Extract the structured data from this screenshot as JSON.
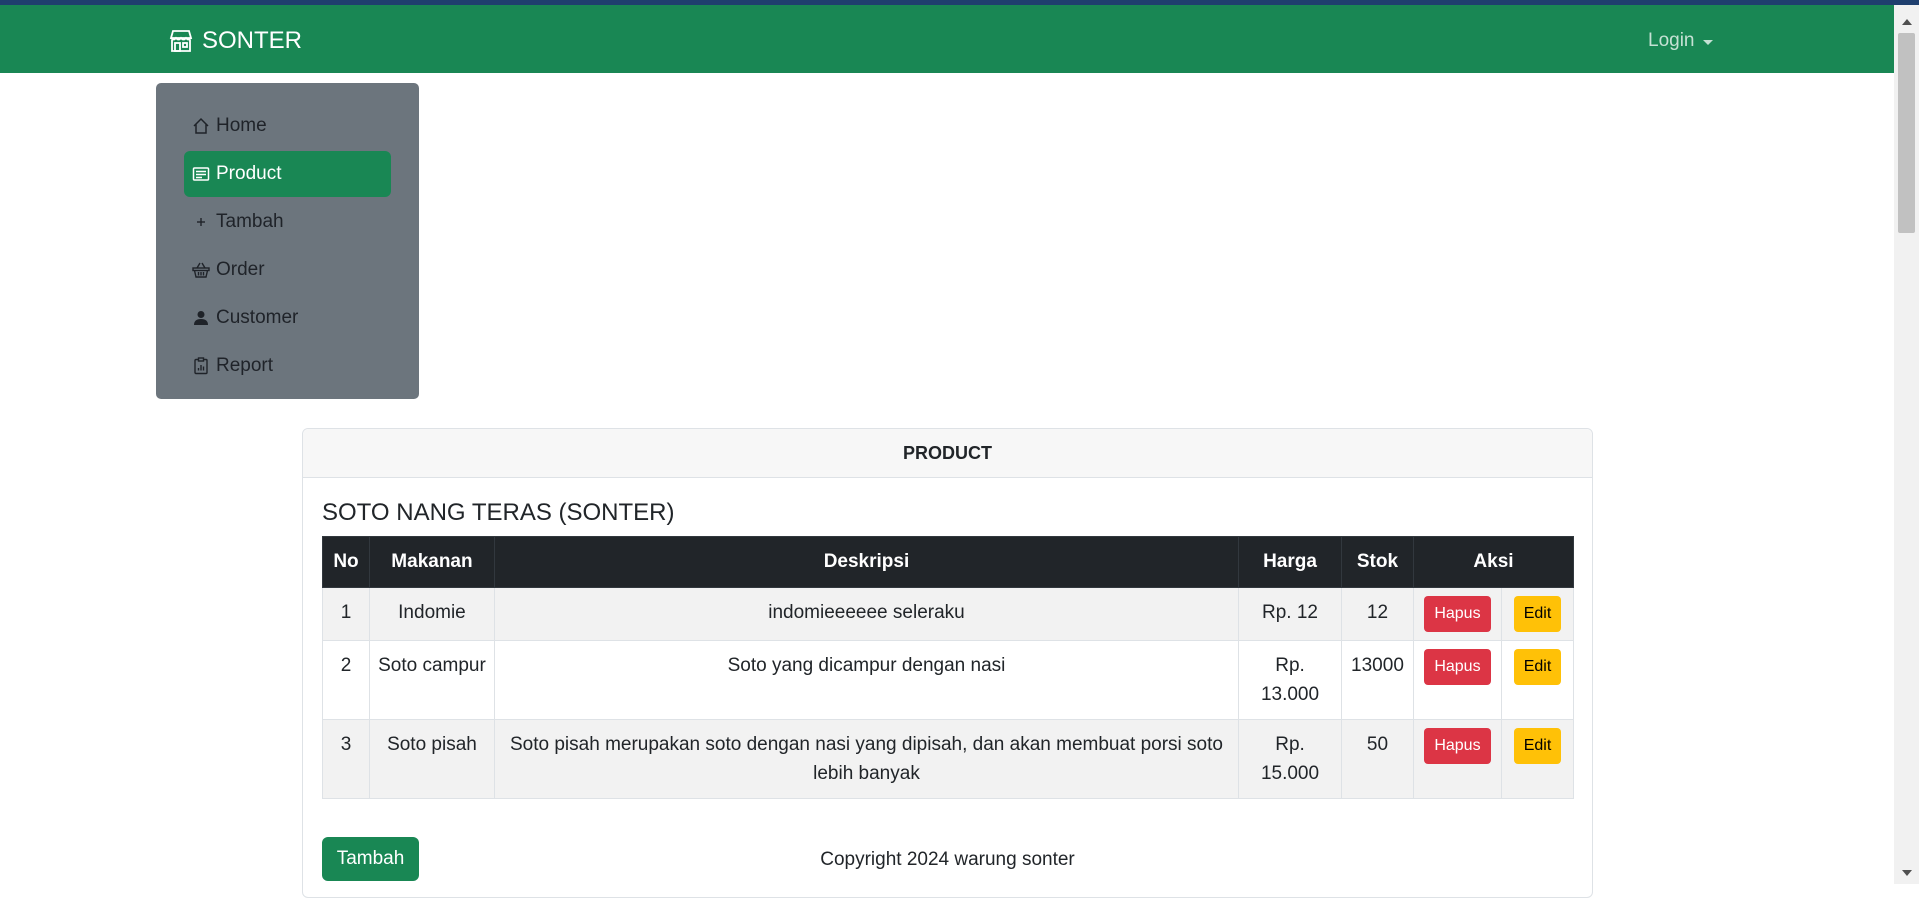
{
  "navbar": {
    "brand": "SONTER",
    "login_label": "Login"
  },
  "sidebar": {
    "items": [
      {
        "label": "Home",
        "icon": "house-icon"
      },
      {
        "label": "Product",
        "icon": "product-list-icon",
        "active": true
      },
      {
        "label": "Tambah",
        "icon": "plus-icon"
      },
      {
        "label": "Order",
        "icon": "basket-icon"
      },
      {
        "label": "Customer",
        "icon": "person-icon"
      },
      {
        "label": "Report",
        "icon": "clipboard-data-icon"
      }
    ]
  },
  "card": {
    "header": "PRODUCT",
    "shop_title": "SOTO NANG TERAS (SONTER)",
    "columns": [
      "No",
      "Makanan",
      "Deskripsi",
      "Harga",
      "Stok",
      "Aksi"
    ],
    "rows": [
      {
        "no": "1",
        "makanan": "Indomie",
        "deskripsi": "indomieeeeee seleraku",
        "harga": "Rp. 12",
        "stok": "12"
      },
      {
        "no": "2",
        "makanan": "Soto campur",
        "deskripsi": "Soto yang dicampur dengan nasi",
        "harga": "Rp. 13.000",
        "stok": "13000"
      },
      {
        "no": "3",
        "makanan": "Soto pisah",
        "deskripsi": "Soto pisah merupakan soto dengan nasi yang dipisah, dan akan membuat porsi soto lebih banyak",
        "harga": "Rp. 15.000",
        "stok": "50"
      }
    ],
    "delete_label": "Hapus",
    "edit_label": "Edit",
    "add_button": "Tambah",
    "copyright": "Copyright 2024 warung sonter"
  },
  "colors": {
    "primary": "#198754",
    "sidebar": "#6c757d",
    "danger": "#dc3545",
    "warning": "#ffc107",
    "table_head": "#212529"
  }
}
